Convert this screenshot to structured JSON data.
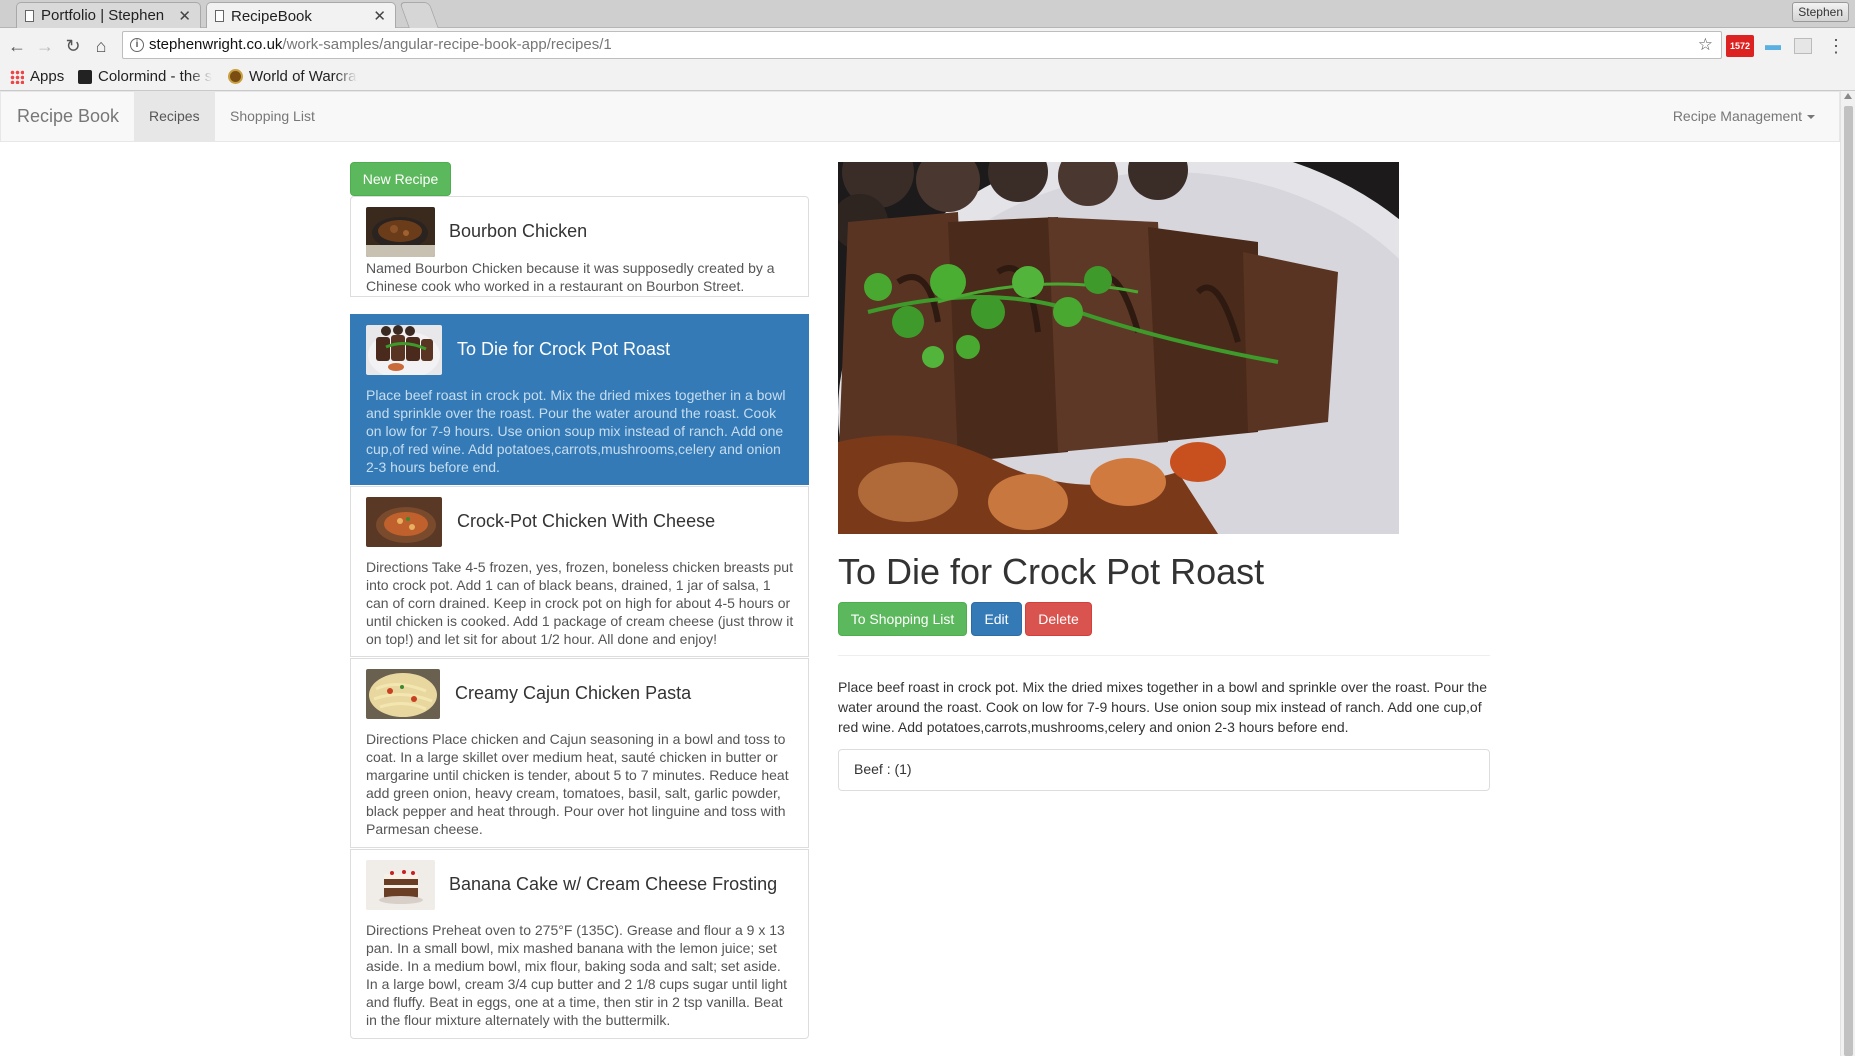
{
  "browser": {
    "tabs": [
      {
        "title": "Portfolio | Stephen",
        "active": false
      },
      {
        "title": "RecipeBook",
        "active": true
      }
    ],
    "profile_name": "Stephen",
    "url_host": "stephenwright.co.uk",
    "url_path": "/work-samples/angular-recipe-book-app/recipes/1",
    "gmail_count": "1572",
    "bookmarks": [
      "Apps",
      "Colormind - the s",
      "World of Warcra"
    ]
  },
  "navbar": {
    "brand": "Recipe Book",
    "links": [
      {
        "label": "Recipes",
        "active": true
      },
      {
        "label": "Shopping List",
        "active": false
      }
    ],
    "dropdown_label": "Recipe Management"
  },
  "new_recipe_label": "New Recipe",
  "recipes": [
    {
      "name": "Bourbon Chicken",
      "description": "Named Bourbon Chicken because it was supposedly created by a Chinese cook who worked in a restaurant on Bourbon Street."
    },
    {
      "name": "To Die for Crock Pot Roast",
      "description": "Place beef roast in crock pot. Mix the dried mixes together in a bowl and sprinkle over the roast. Pour the water around the roast. Cook on low for 7-9 hours. Use onion soup mix instead of ranch. Add one cup,of red wine. Add potatoes,carrots,mushrooms,celery and onion 2-3 hours before end."
    },
    {
      "name": "Crock-Pot Chicken With Cheese",
      "description": "Directions Take 4-5 frozen, yes, frozen, boneless chicken breasts put into crock pot. Add 1 can of black beans, drained, 1 jar of salsa, 1 can of corn drained. Keep in crock pot on high for about 4-5 hours or until chicken is cooked. Add 1 package of cream cheese (just throw it on top!) and let sit for about 1/2 hour. All done and enjoy!"
    },
    {
      "name": "Creamy Cajun Chicken Pasta",
      "description": "Directions Place chicken and Cajun seasoning in a bowl and toss to coat. In a large skillet over medium heat, sauté chicken in butter or margarine until chicken is tender, about 5 to 7 minutes. Reduce heat add green onion, heavy cream, tomatoes, basil, salt, garlic powder, black pepper and heat through. Pour over hot linguine and toss with Parmesan cheese."
    },
    {
      "name": "Banana Cake w/ Cream Cheese Frosting",
      "description": "Directions Preheat oven to 275°F (135C). Grease and flour a 9 x 13 pan. In a small bowl, mix mashed banana with the lemon juice; set aside. In a medium bowl, mix flour, baking soda and salt; set aside. In a large bowl, cream 3/4 cup butter and 2 1/8 cups sugar until light and fluffy. Beat in eggs, one at a time, then stir in 2 tsp vanilla. Beat in the flour mixture alternately with the buttermilk."
    }
  ],
  "detail": {
    "title": "To Die for Crock Pot Roast",
    "to_shopping_list_label": "To Shopping List",
    "edit_label": "Edit",
    "delete_label": "Delete",
    "description": "Place beef roast in crock pot. Mix the dried mixes together in a bowl and sprinkle over the roast. Pour the water around the roast. Cook on low for 7-9 hours. Use onion soup mix instead of ranch. Add one cup,of red wine. Add potatoes,carrots,mushrooms,celery and onion 2-3 hours before end.",
    "ingredients": [
      "Beef : (1)"
    ]
  },
  "colors": {
    "primary": "#337ab7",
    "success": "#5cb85c",
    "danger": "#d9534f"
  }
}
